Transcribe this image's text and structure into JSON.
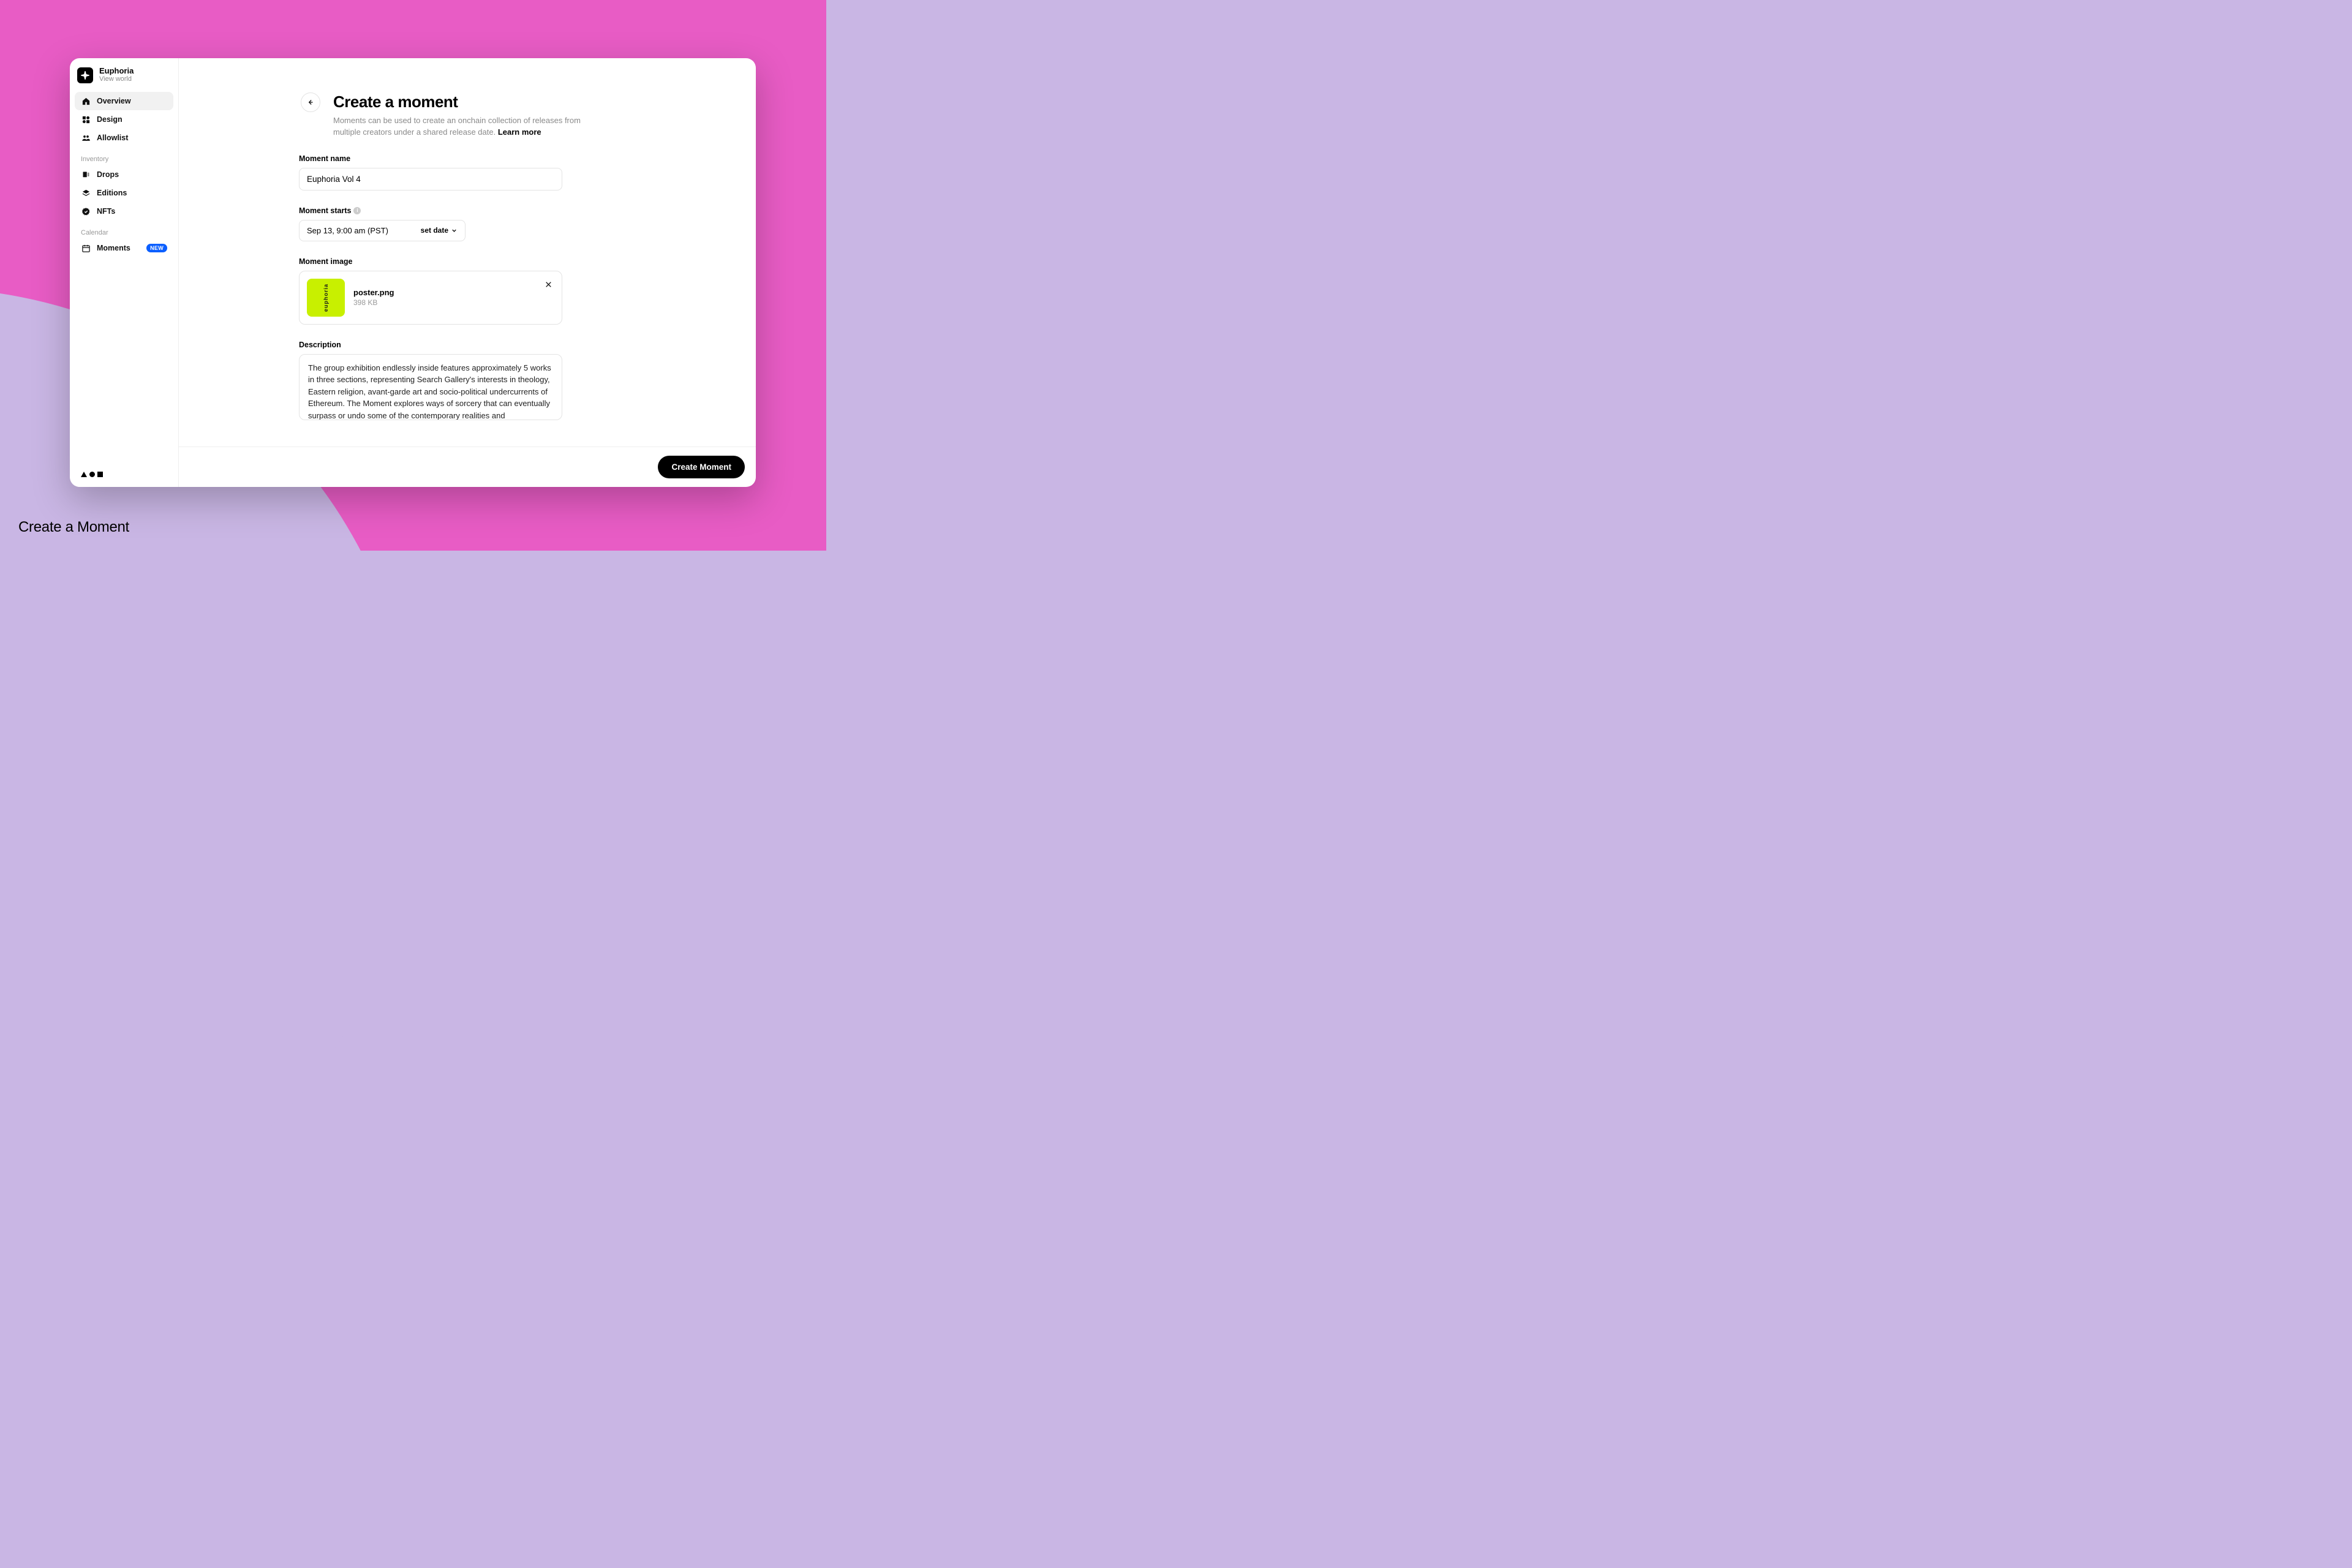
{
  "caption": "Create a Moment",
  "world": {
    "name": "Euphoria",
    "subtitle": "View world"
  },
  "sidebar": {
    "main_items": [
      {
        "label": "Overview",
        "active": true
      },
      {
        "label": "Design",
        "active": false
      },
      {
        "label": "Allowlist",
        "active": false
      }
    ],
    "inventory_label": "Inventory",
    "inventory_items": [
      {
        "label": "Drops"
      },
      {
        "label": "Editions"
      },
      {
        "label": "NFTs"
      }
    ],
    "calendar_label": "Calendar",
    "calendar_items": [
      {
        "label": "Moments",
        "badge": "NEW"
      }
    ]
  },
  "page": {
    "title": "Create a moment",
    "description": "Moments can be used to create an onchain collection of releases from multiple creators under a shared release date.",
    "learn_more": "Learn more"
  },
  "form": {
    "name_label": "Moment name",
    "name_value": "Euphoria Vol 4",
    "starts_label": "Moment starts",
    "starts_value": "Sep 13, 9:00 am (PST)",
    "set_date_label": "set date",
    "image_label": "Moment image",
    "image_file_name": "poster.png",
    "image_file_size": "398 KB",
    "image_thumb_text": "euphoria",
    "description_label": "Description",
    "description_value": "The group exhibition endlessly inside features approximately 5 works in three sections, representing Search Gallery's interests in theology, Eastern religion, avant-garde art and socio-political undercurrents of Ethereum. The Moment explores ways of sorcery that can eventually surpass or undo some of the contemporary realities and subjectivities. It seeks forgiveness after being involved in a productive alienation from concepts through experience and"
  },
  "footer": {
    "create_label": "Create Moment"
  }
}
